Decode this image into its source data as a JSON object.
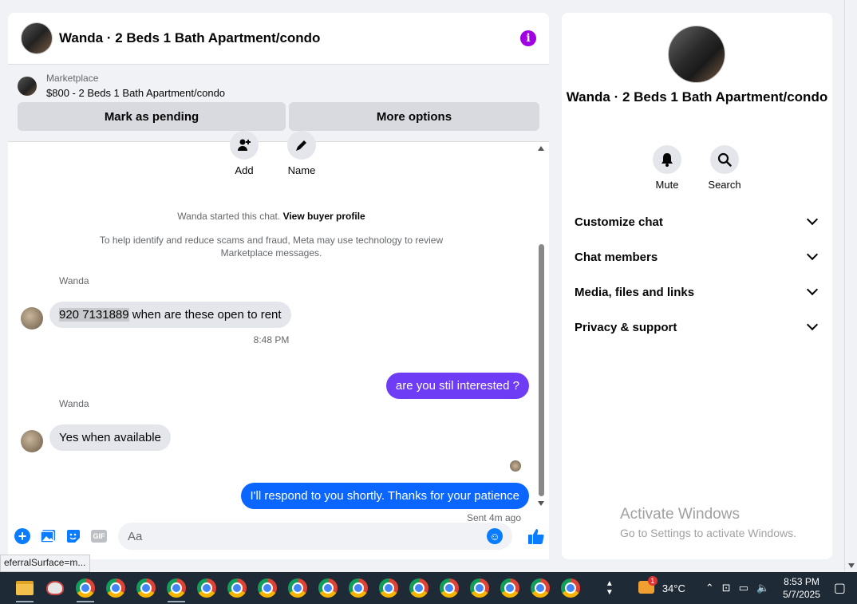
{
  "chat": {
    "title": "Wanda · 2 Beds 1 Bath Apartment/condo",
    "marketplace": {
      "label": "Marketplace",
      "listing": "$800 - 2 Beds 1 Bath Apartment/condo",
      "pending_button": "Mark as pending",
      "options_button": "More options"
    },
    "quick_actions": {
      "add": "Add",
      "name": "Name"
    },
    "started_text": "Wanda started this chat.",
    "buyer_profile_link": "View buyer profile",
    "scam_notice": "To help identify and reduce scams and fraud, Meta may use technology to review Marketplace messages.",
    "messages": [
      {
        "sender": "Wanda",
        "highlight": "920 7131889",
        "text": " when are these open to rent"
      },
      {
        "timestamp": "8:48 PM"
      },
      {
        "text": "are you stil interested ?"
      },
      {
        "sender": "Wanda",
        "text": "Yes when available"
      },
      {
        "text": "I'll respond to you shortly. Thanks for your patience",
        "status": "Sent 4m ago"
      }
    ],
    "composer": {
      "placeholder": "Aa",
      "gif_label": "GIF"
    }
  },
  "info_panel": {
    "name": "Wanda · 2 Beds 1 Bath Apartment/condo",
    "actions": {
      "mute": "Mute",
      "search": "Search"
    },
    "menu": [
      "Customize chat",
      "Chat members",
      "Media, files and links",
      "Privacy & support"
    ]
  },
  "watermark": {
    "line1": "Activate Windows",
    "line2": "Go to Settings to activate Windows."
  },
  "status_url": "eferralSurface=m...",
  "taskbar": {
    "temperature": "34°C",
    "notification_count": "1",
    "time": "8:53 PM",
    "date": "5/7/2025"
  },
  "colors": {
    "outgoing_purple": "#6f3cf5",
    "outgoing_blue": "#0a66ff",
    "accent": "#0a7cff",
    "info": "#a100e5"
  }
}
